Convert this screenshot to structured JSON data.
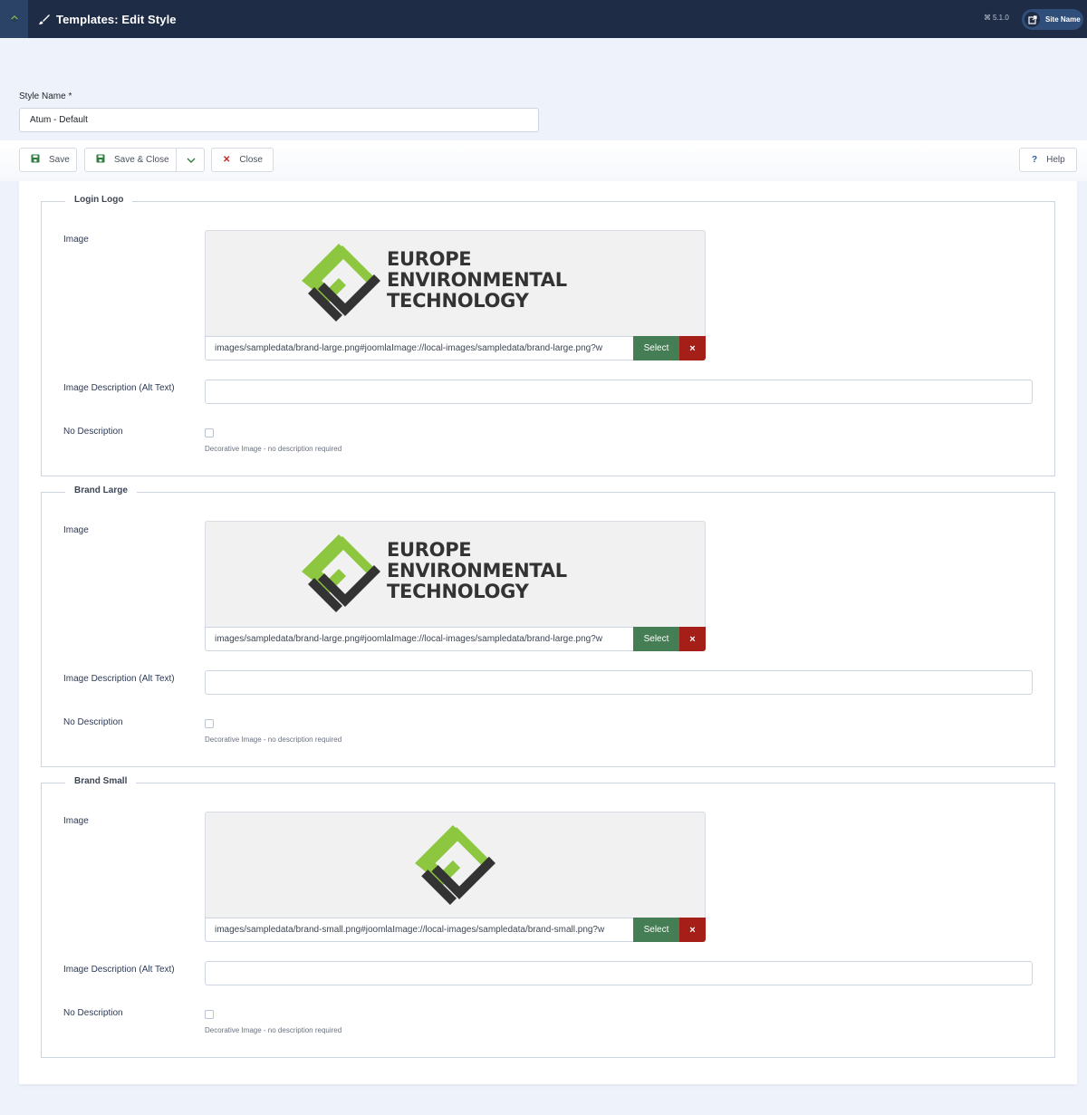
{
  "header": {
    "title": "Templates: Edit Style",
    "version": "5.1.0",
    "site_button_label": "Site Name",
    "colors": {
      "bar": "#1f2c45",
      "toggle": "#2a4366",
      "accent_green": "#8dc63f"
    }
  },
  "style_name": {
    "label": "Style Name *",
    "value": "Atum - Default"
  },
  "toolbar": {
    "save_label": "Save",
    "save_close_label": "Save & Close",
    "close_label": "Close",
    "help_label": "Help"
  },
  "sections": [
    {
      "legend": "Login Logo",
      "image_label": "Image",
      "logo_text": [
        "EUROPE",
        "ENVIRONMENTAL",
        "TECHNOLOGY"
      ],
      "path": "images/sampledata/brand-large.png#joomlaImage://local-images/sampledata/brand-large.png?w",
      "select_label": "Select",
      "clear_label": "×",
      "alt_label": "Image Description (Alt Text)",
      "alt_value": "",
      "no_desc_label": "No Description",
      "no_desc_checked": false,
      "no_desc_hint": "Decorative Image - no description required"
    },
    {
      "legend": "Brand Large",
      "image_label": "Image",
      "logo_text": [
        "EUROPE",
        "ENVIRONMENTAL",
        "TECHNOLOGY"
      ],
      "path": "images/sampledata/brand-large.png#joomlaImage://local-images/sampledata/brand-large.png?w",
      "select_label": "Select",
      "clear_label": "×",
      "alt_label": "Image Description (Alt Text)",
      "alt_value": "",
      "no_desc_label": "No Description",
      "no_desc_checked": false,
      "no_desc_hint": "Decorative Image - no description required"
    },
    {
      "legend": "Brand Small",
      "image_label": "Image",
      "path": "images/sampledata/brand-small.png#joomlaImage://local-images/sampledata/brand-small.png?w",
      "select_label": "Select",
      "clear_label": "×",
      "alt_label": "Image Description (Alt Text)",
      "alt_value": "",
      "no_desc_label": "No Description",
      "no_desc_checked": false,
      "no_desc_hint": "Decorative Image - no description required"
    }
  ],
  "colors": {
    "select_button": "#457d54",
    "clear_button": "#a51f18",
    "logo_green": "#8dc63f",
    "logo_dark": "#333333"
  }
}
